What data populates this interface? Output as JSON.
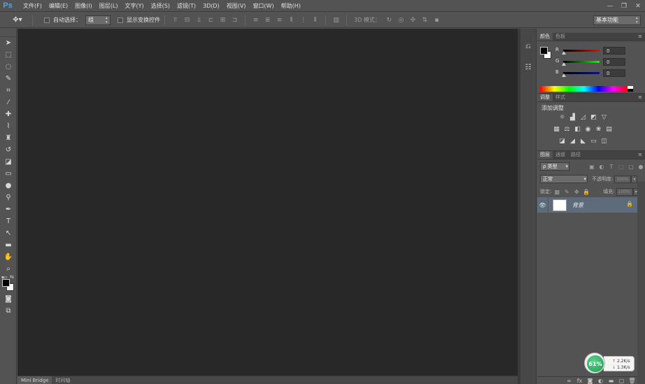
{
  "app": {
    "logo": "Ps"
  },
  "menu": [
    "文件(F)",
    "编辑(E)",
    "图像(I)",
    "图层(L)",
    "文字(Y)",
    "选择(S)",
    "滤镜(T)",
    "3D(D)",
    "视图(V)",
    "窗口(W)",
    "帮助(H)"
  ],
  "window_controls": {
    "minimize": "—",
    "restore": "❐",
    "close": "✕"
  },
  "options": {
    "tool_icon": "move-tool-icon",
    "auto_select_label": "自动选择：",
    "auto_select_value": "组",
    "transform_label": "显示变换控件",
    "mode3d_label": "3D 模式：",
    "workspace": "基本功能"
  },
  "canvas": {
    "background": "#282828"
  },
  "status_tabs": [
    "Mini Bridge",
    "时间轴"
  ],
  "color_panel": {
    "tabs": [
      "颜色",
      "色板"
    ],
    "sliders": [
      {
        "label": "R",
        "value": "0",
        "gradient": "linear-gradient(to right,#000,#f00)"
      },
      {
        "label": "G",
        "value": "0",
        "gradient": "linear-gradient(to right,#000,#0f0)"
      },
      {
        "label": "B",
        "value": "0",
        "gradient": "linear-gradient(to right,#000,#00f)"
      }
    ]
  },
  "adjust_panel": {
    "tabs": [
      "调整",
      "样式"
    ],
    "title": "添加调整"
  },
  "layers_panel": {
    "tabs": [
      "图层",
      "通道",
      "路径"
    ],
    "kind_filter": "ρ 类型",
    "blend_mode": "正常",
    "opacity_label": "不透明度:",
    "opacity_value": "100%",
    "lock_label": "锁定:",
    "fill_label": "填充:",
    "fill_value": "100%",
    "layer_name": "背景"
  },
  "network": {
    "percent": "61%",
    "upload": "2.2K/s",
    "download": "1.3K/s"
  }
}
